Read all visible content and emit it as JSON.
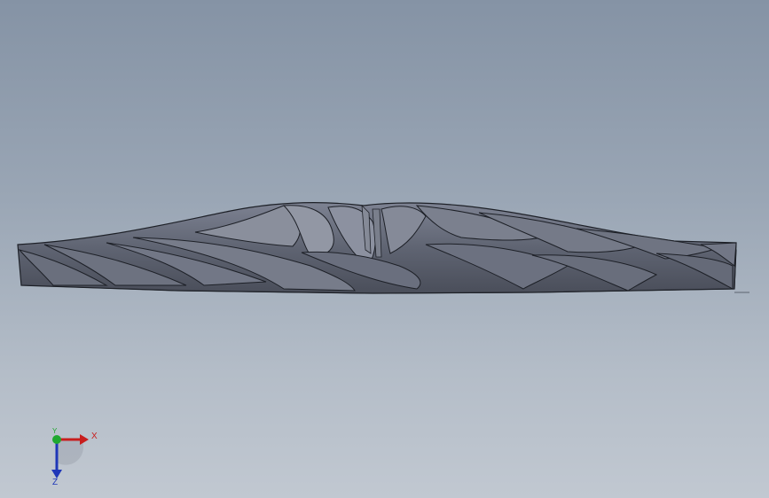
{
  "viewport": {
    "background_top": "#8593a5",
    "background_bottom": "#c1c8d1"
  },
  "model": {
    "icon": "impeller-blades-side-view",
    "fill_color": "#5d6270",
    "edge_color": "#1d2027"
  },
  "triad": {
    "x_label": "X",
    "y_label": "Y",
    "z_label": "Z",
    "x_color": "#c81e1e",
    "y_color": "#1fa82f",
    "z_color": "#1f37b8"
  }
}
